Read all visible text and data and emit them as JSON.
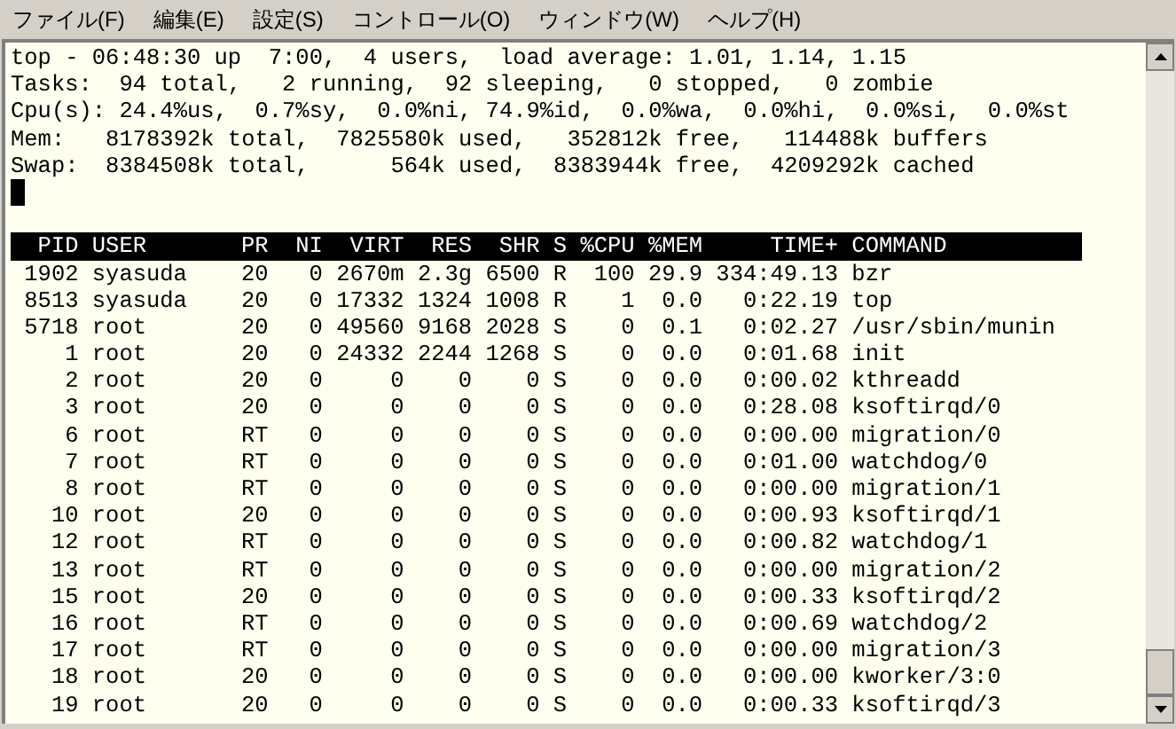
{
  "menu": [
    "ファイル(F)",
    "編集(E)",
    "設定(S)",
    "コントロール(O)",
    "ウィンドウ(W)",
    "ヘルプ(H)"
  ],
  "summary_lines": [
    "top - 06:48:30 up  7:00,  4 users,  load average: 1.01, 1.14, 1.15",
    "Tasks:  94 total,   2 running,  92 sleeping,   0 stopped,   0 zombie",
    "Cpu(s): 24.4%us,  0.7%sy,  0.0%ni, 74.9%id,  0.0%wa,  0.0%hi,  0.0%si,  0.0%st",
    "Mem:   8178392k total,  7825580k used,   352812k free,   114488k buffers",
    "Swap:  8384508k total,      564k used,  8383944k free,  4209292k cached"
  ],
  "process_table": {
    "columns": [
      "PID",
      "USER",
      "PR",
      "NI",
      "VIRT",
      "RES",
      "SHR",
      "S",
      "%CPU",
      "%MEM",
      "TIME+",
      "COMMAND"
    ],
    "rows": [
      [
        "1902",
        "syasuda",
        "20",
        "0",
        "2670m",
        "2.3g",
        "6500",
        "R",
        "100",
        "29.9",
        "334:49.13",
        "bzr"
      ],
      [
        "8513",
        "syasuda",
        "20",
        "0",
        "17332",
        "1324",
        "1008",
        "R",
        "1",
        "0.0",
        "0:22.19",
        "top"
      ],
      [
        "5718",
        "root",
        "20",
        "0",
        "49560",
        "9168",
        "2028",
        "S",
        "0",
        "0.1",
        "0:02.27",
        "/usr/sbin/munin"
      ],
      [
        "1",
        "root",
        "20",
        "0",
        "24332",
        "2244",
        "1268",
        "S",
        "0",
        "0.0",
        "0:01.68",
        "init"
      ],
      [
        "2",
        "root",
        "20",
        "0",
        "0",
        "0",
        "0",
        "S",
        "0",
        "0.0",
        "0:00.02",
        "kthreadd"
      ],
      [
        "3",
        "root",
        "20",
        "0",
        "0",
        "0",
        "0",
        "S",
        "0",
        "0.0",
        "0:28.08",
        "ksoftirqd/0"
      ],
      [
        "6",
        "root",
        "RT",
        "0",
        "0",
        "0",
        "0",
        "S",
        "0",
        "0.0",
        "0:00.00",
        "migration/0"
      ],
      [
        "7",
        "root",
        "RT",
        "0",
        "0",
        "0",
        "0",
        "S",
        "0",
        "0.0",
        "0:01.00",
        "watchdog/0"
      ],
      [
        "8",
        "root",
        "RT",
        "0",
        "0",
        "0",
        "0",
        "S",
        "0",
        "0.0",
        "0:00.00",
        "migration/1"
      ],
      [
        "10",
        "root",
        "20",
        "0",
        "0",
        "0",
        "0",
        "S",
        "0",
        "0.0",
        "0:00.93",
        "ksoftirqd/1"
      ],
      [
        "12",
        "root",
        "RT",
        "0",
        "0",
        "0",
        "0",
        "S",
        "0",
        "0.0",
        "0:00.82",
        "watchdog/1"
      ],
      [
        "13",
        "root",
        "RT",
        "0",
        "0",
        "0",
        "0",
        "S",
        "0",
        "0.0",
        "0:00.00",
        "migration/2"
      ],
      [
        "15",
        "root",
        "20",
        "0",
        "0",
        "0",
        "0",
        "S",
        "0",
        "0.0",
        "0:00.33",
        "ksoftirqd/2"
      ],
      [
        "16",
        "root",
        "RT",
        "0",
        "0",
        "0",
        "0",
        "S",
        "0",
        "0.0",
        "0:00.69",
        "watchdog/2"
      ],
      [
        "17",
        "root",
        "RT",
        "0",
        "0",
        "0",
        "0",
        "S",
        "0",
        "0.0",
        "0:00.00",
        "migration/3"
      ],
      [
        "18",
        "root",
        "20",
        "0",
        "0",
        "0",
        "0",
        "S",
        "0",
        "0.0",
        "0:00.00",
        "kworker/3:0"
      ],
      [
        "19",
        "root",
        "20",
        "0",
        "0",
        "0",
        "0",
        "S",
        "0",
        "0.0",
        "0:00.33",
        "ksoftirqd/3"
      ]
    ]
  }
}
